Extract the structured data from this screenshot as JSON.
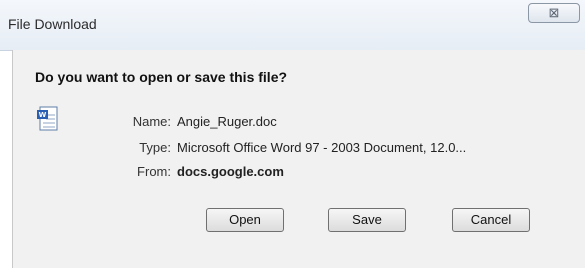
{
  "window": {
    "title": "File Download",
    "close_icon": "close-icon",
    "close_glyph": "⊠"
  },
  "dialog": {
    "question": "Do you want to open or save this file?",
    "file_icon": "word-document-icon",
    "name_label": "Name:",
    "name_value": "Angie_Ruger.doc",
    "type_label": "Type:",
    "type_value": "Microsoft Office Word 97 - 2003 Document, 12.0...",
    "from_label": "From:",
    "from_value": "docs.google.com"
  },
  "buttons": {
    "open": "Open",
    "save": "Save",
    "cancel": "Cancel"
  }
}
